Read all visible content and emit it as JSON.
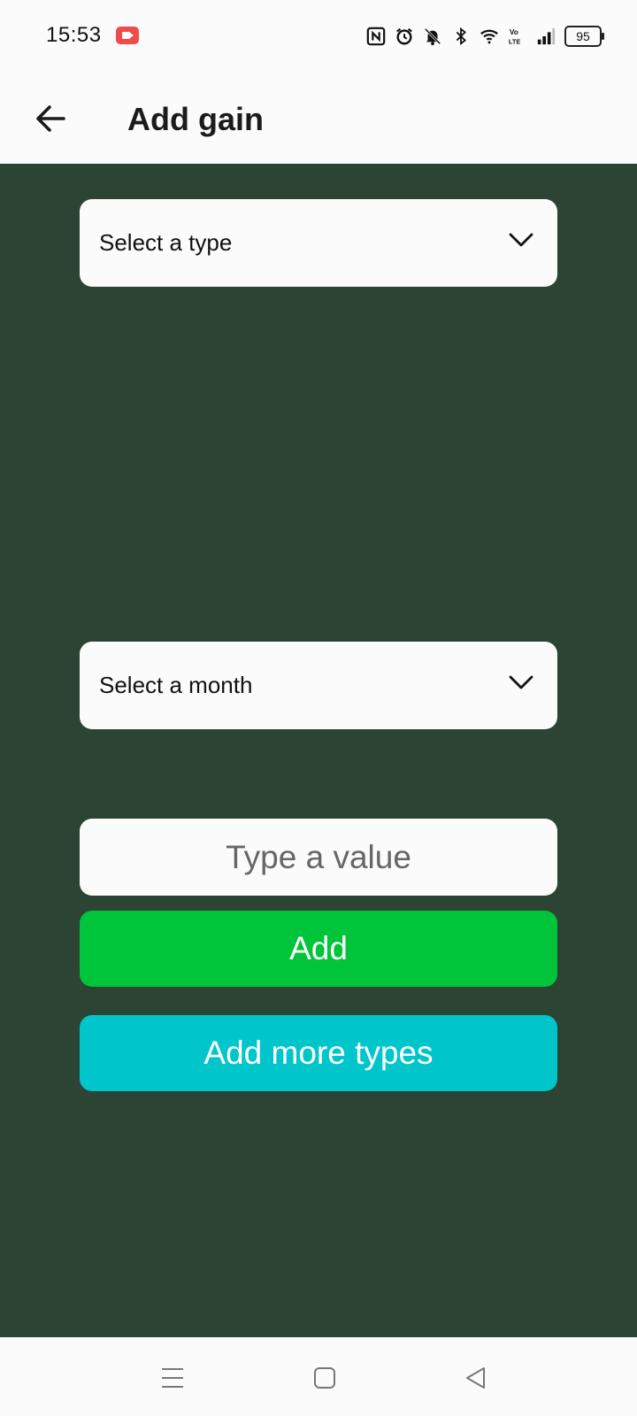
{
  "status_bar": {
    "time": "15:53",
    "battery": "95",
    "icons": [
      "screen-record-icon",
      "nfc-icon",
      "alarm-icon",
      "bell-off-icon",
      "bluetooth-icon",
      "wifi-icon",
      "volte-icon",
      "signal-icon",
      "battery-icon"
    ]
  },
  "app_bar": {
    "title": "Add gain",
    "back_icon": "arrow-left-icon"
  },
  "form": {
    "type_select": {
      "label": "Select a type",
      "icon": "chevron-down-icon"
    },
    "month_select": {
      "label": "Select a month",
      "icon": "chevron-down-icon"
    },
    "value_input": {
      "placeholder": "Type a value",
      "value": ""
    },
    "add_button": {
      "label": "Add"
    },
    "add_more_button": {
      "label": "Add more types"
    }
  },
  "nav_bar": {
    "icons": [
      "menu-icon",
      "home-square-icon",
      "back-triangle-icon"
    ]
  },
  "colors": {
    "background_main": "#2c4433",
    "surface": "#fbfbfb",
    "add_button": "#00c53a",
    "add_more_button": "#00c6cb",
    "record_badge": "#ef4b4b"
  }
}
